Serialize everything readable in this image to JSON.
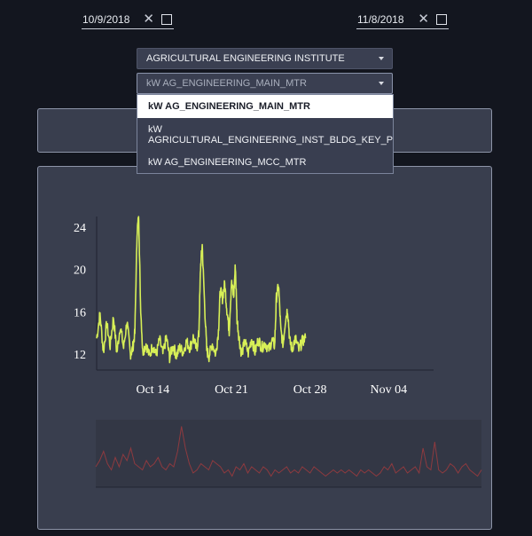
{
  "dates": {
    "start": "10/9/2018",
    "end": "11/8/2018",
    "clear_glyph": "✕"
  },
  "site_select": {
    "value": "AGRICULTURAL ENGINEERING INSTITUTE"
  },
  "meter_select": {
    "value": "kW AG_ENGINEERING_MAIN_MTR",
    "options": [
      "kW AG_ENGINEERING_MAIN_MTR",
      "kW AGRICULTURAL_ENGINEERING_INST_BLDG_KEY_PERF_IND",
      "kW AG_ENGINEERING_MCC_MTR"
    ],
    "option_2_line_1": "kW",
    "option_2_line_2": "AGRICULTURAL_ENGINEERING_INST_BLDG_KEY_PERF_IND"
  },
  "colors": {
    "line": "#d7ef57",
    "context_line": "#8e3a3f",
    "background": "#13161f",
    "panel": "#393e4e"
  },
  "chart_data": {
    "type": "line",
    "x_ticks": [
      "Oct 14",
      "Oct 21",
      "Oct 28",
      "Nov 04"
    ],
    "y_ticks": [
      12,
      16,
      20,
      24
    ],
    "xlim_days": [
      9,
      39
    ],
    "ylim": [
      10.5,
      25
    ],
    "series": [
      {
        "values": [
          [
            9.0,
            13.5
          ],
          [
            9.3,
            15.8
          ],
          [
            9.6,
            12.2
          ],
          [
            9.9,
            14.9
          ],
          [
            10.2,
            12.8
          ],
          [
            10.5,
            15.5
          ],
          [
            10.8,
            12.1
          ],
          [
            11.1,
            14.7
          ],
          [
            11.4,
            12.6
          ],
          [
            11.7,
            15.1
          ],
          [
            12.0,
            12.0
          ],
          [
            12.2,
            12.5
          ],
          [
            12.4,
            14.0
          ],
          [
            12.6,
            23.6
          ],
          [
            12.75,
            25.0
          ],
          [
            12.9,
            17.0
          ],
          [
            13.1,
            12.2
          ],
          [
            13.4,
            13.0
          ],
          [
            13.7,
            11.8
          ],
          [
            14.0,
            12.9
          ],
          [
            14.3,
            11.9
          ],
          [
            14.6,
            13.4
          ],
          [
            14.9,
            12.0
          ],
          [
            15.2,
            13.6
          ],
          [
            15.5,
            11.7
          ],
          [
            15.8,
            12.8
          ],
          [
            16.1,
            11.9
          ],
          [
            16.4,
            12.6
          ],
          [
            16.7,
            12.2
          ],
          [
            17.0,
            13.2
          ],
          [
            17.3,
            12.6
          ],
          [
            17.6,
            13.6
          ],
          [
            17.9,
            12.4
          ],
          [
            18.1,
            13.9
          ],
          [
            18.25,
            20.2
          ],
          [
            18.4,
            22.3
          ],
          [
            18.6,
            17.0
          ],
          [
            18.8,
            12.4
          ],
          [
            19.0,
            11.8
          ],
          [
            19.3,
            13.0
          ],
          [
            19.6,
            12.0
          ],
          [
            19.85,
            14.2
          ],
          [
            20.0,
            18.0
          ],
          [
            20.2,
            17.3
          ],
          [
            20.4,
            18.6
          ],
          [
            20.6,
            16.2
          ],
          [
            20.8,
            14.2
          ],
          [
            21.0,
            18.8
          ],
          [
            21.2,
            17.4
          ],
          [
            21.35,
            20.4
          ],
          [
            21.5,
            15.3
          ],
          [
            21.7,
            13.4
          ],
          [
            21.9,
            12.0
          ],
          [
            22.2,
            13.2
          ],
          [
            22.5,
            12.1
          ],
          [
            22.8,
            13.5
          ],
          [
            23.1,
            12.2
          ],
          [
            23.4,
            13.4
          ],
          [
            23.7,
            12.6
          ],
          [
            24.0,
            13.1
          ],
          [
            24.3,
            12.4
          ],
          [
            24.6,
            13.3
          ],
          [
            24.85,
            12.8
          ],
          [
            25.0,
            17.3
          ],
          [
            25.2,
            18.5
          ],
          [
            25.4,
            14.2
          ],
          [
            25.6,
            12.9
          ],
          [
            25.8,
            15.2
          ],
          [
            26.0,
            16.3
          ],
          [
            26.2,
            13.2
          ],
          [
            26.4,
            12.5
          ],
          [
            26.7,
            13.5
          ],
          [
            27.0,
            12.4
          ],
          [
            27.3,
            13.2
          ],
          [
            27.6,
            13.5
          ]
        ]
      }
    ],
    "context_values": [
      0.3,
      0.4,
      0.55,
      0.35,
      0.25,
      0.45,
      0.3,
      0.5,
      0.4,
      0.6,
      0.35,
      0.3,
      0.25,
      0.4,
      0.3,
      0.35,
      0.45,
      0.3,
      0.25,
      0.35,
      0.3,
      0.55,
      0.95,
      0.6,
      0.35,
      0.2,
      0.25,
      0.35,
      0.3,
      0.25,
      0.4,
      0.35,
      0.3,
      0.2,
      0.25,
      0.15,
      0.3,
      0.25,
      0.35,
      0.2,
      0.3,
      0.25,
      0.2,
      0.3,
      0.25,
      0.15,
      0.25,
      0.2,
      0.25,
      0.3,
      0.2,
      0.25,
      0.2,
      0.3,
      0.25,
      0.2,
      0.3,
      0.25,
      0.2,
      0.15,
      0.2,
      0.25,
      0.2,
      0.25,
      0.2,
      0.25,
      0.2,
      0.15,
      0.25,
      0.2,
      0.25,
      0.2,
      0.15,
      0.2,
      0.3,
      0.25,
      0.35,
      0.2,
      0.25,
      0.3,
      0.2,
      0.25,
      0.3,
      0.2,
      0.6,
      0.3,
      0.25,
      0.7,
      0.25,
      0.2,
      0.25,
      0.35,
      0.3,
      0.2,
      0.3,
      0.35,
      0.25,
      0.2,
      0.15,
      0.25
    ]
  }
}
